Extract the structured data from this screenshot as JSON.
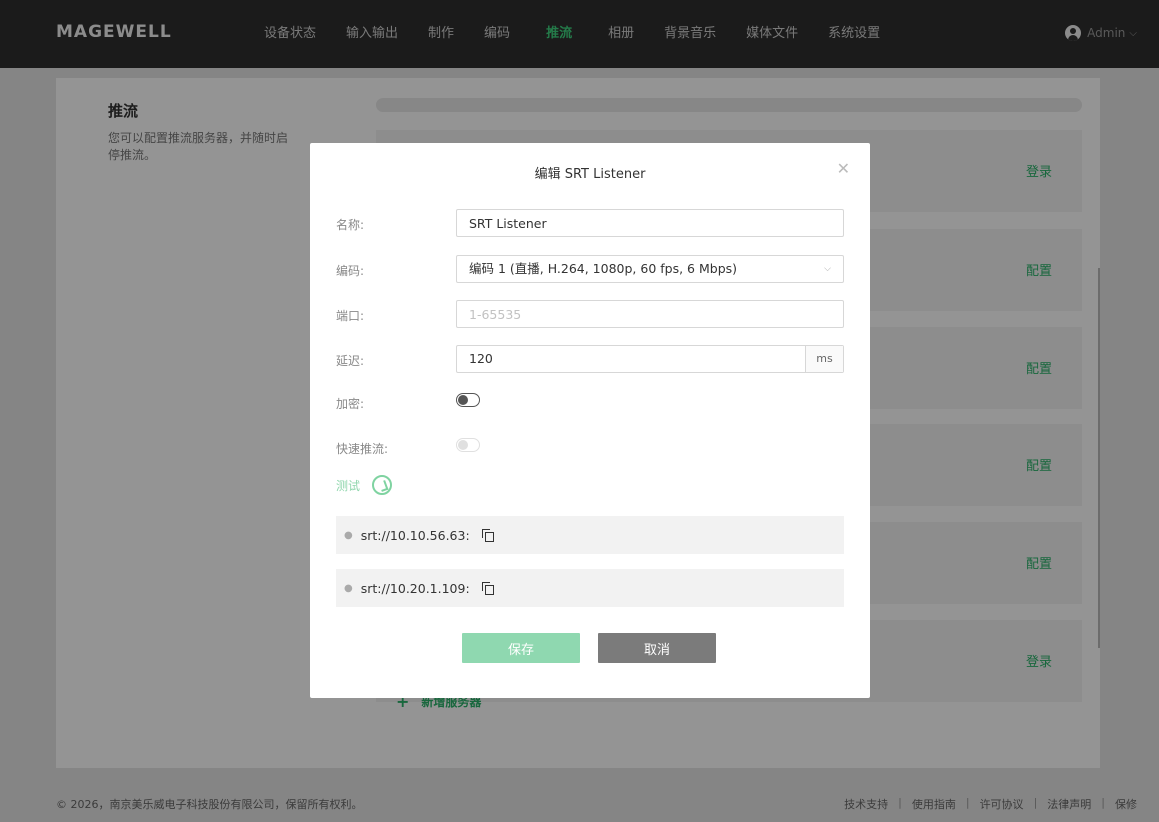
{
  "app": {
    "logo": "MAGEWELL",
    "nav": [
      {
        "label": "设备状态",
        "active": false
      },
      {
        "label": "输入输出",
        "active": false
      },
      {
        "label": "制作",
        "active": false
      },
      {
        "label": "编码",
        "active": false
      },
      {
        "label": "推流",
        "active": true
      },
      {
        "label": "相册",
        "active": false
      },
      {
        "label": "背景音乐",
        "active": false
      },
      {
        "label": "媒体文件",
        "active": false
      },
      {
        "label": "系统设置",
        "active": false
      }
    ],
    "user": "Admin"
  },
  "page": {
    "title": "推流",
    "description": "您可以配置推流服务器，并随时启停推流。",
    "server_actions": [
      "登录",
      "配置",
      "配置",
      "配置",
      "配置",
      "登录"
    ],
    "add_server": "新增服务器"
  },
  "modal": {
    "title": "编辑 SRT Listener",
    "fields": {
      "name_label": "名称:",
      "name_value": "SRT Listener",
      "encoding_label": "编码:",
      "encoding_value": "编码 1 (直播, H.264, 1080p, 60 fps, 6 Mbps)",
      "port_label": "端口:",
      "port_placeholder": "1-65535",
      "latency_label": "延迟:",
      "latency_value": "120",
      "latency_unit": "ms",
      "encryption_label": "加密:",
      "encryption_on": false,
      "fast_push_label": "快速推流:",
      "fast_push_on": false
    },
    "test_label": "测试",
    "urls": [
      "srt://10.10.56.63:",
      "srt://10.20.1.109:"
    ],
    "save_label": "保存",
    "cancel_label": "取消"
  },
  "footer": {
    "copyright": "© 2026，南京美乐威电子科技股份有限公司，保留所有权利。",
    "links": [
      "技术支持",
      "使用指南",
      "许可协议",
      "法律声明",
      "保修"
    ]
  },
  "colors": {
    "accent": "#3ed37e",
    "action_green": "#2ab26a",
    "save_button": "#8fd8b0",
    "cancel_button": "#7b7b7b",
    "topbar": "#2f2f2f"
  }
}
